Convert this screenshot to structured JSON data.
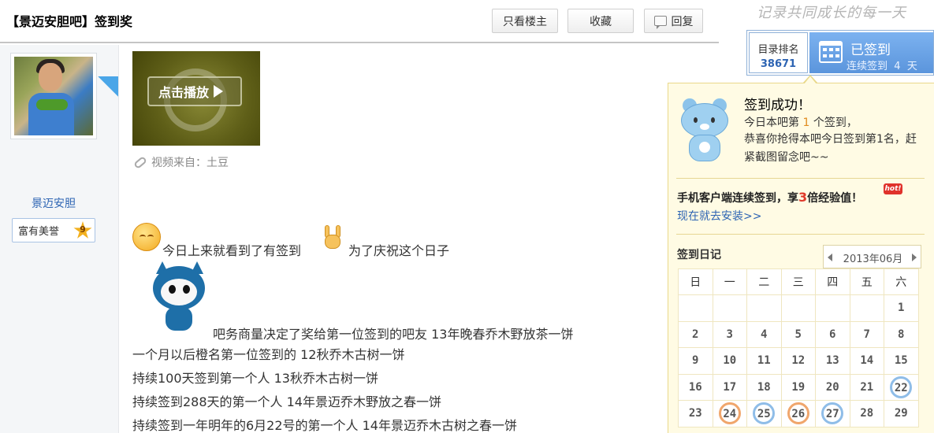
{
  "thread": {
    "title": "【景迈安胆吧】签到奖",
    "buttons": {
      "only_author": "只看楼主",
      "collect": "收藏",
      "reply": "回复"
    }
  },
  "author": {
    "name": "景迈安胆",
    "honor": "富有美誉",
    "honor_level": "9"
  },
  "post": {
    "video_play_label": "点击播放",
    "video_source": "视频来自：土豆",
    "lines": [
      "今日上来就看到了有签到",
      "为了庆祝这个日子",
      "吧务商量决定了奖给第一位签到的吧友 13年晚春乔木野放茶一饼",
      "一个月以后橙名第一位签到的 12秋乔木古树一饼",
      "持续100天签到第一个人 13秋乔木古树一饼",
      "持续签到288天的第一个人 14年景迈乔木野放之春一饼",
      "持续签到一年明年的6月22号的第一个人 14年景迈乔木古树之春一饼"
    ],
    "emojis": [
      "smile-emoji",
      "rock-hand-emoji",
      "blue-cat-emoji"
    ]
  },
  "sidebar": {
    "slogan": "记录共同成长的每一天",
    "rank_label": "目录排名",
    "rank_value": "38671",
    "signed_label": "已签到",
    "streak_prefix": "连续签到",
    "streak_days": "4",
    "streak_suffix": "天"
  },
  "popup": {
    "title": "签到成功！",
    "line1_prefix": "今日本吧第",
    "line1_rank": "1",
    "line1_suffix": "个签到，",
    "line2": "恭喜你抢得本吧今日签到第1名，赶",
    "line3": "紧截图留念吧~~",
    "mobile_prefix": "手机客户端连续签到，享",
    "mobile_multiplier": "3",
    "mobile_suffix": "倍经验值！",
    "hot_badge": "hot!",
    "install_link": "现在就去安装>>",
    "diary_title": "签到日记",
    "month": "2013年06月",
    "weekdays": [
      "日",
      "一",
      "二",
      "三",
      "四",
      "五",
      "六"
    ],
    "calendar_rows": [
      [
        "",
        "",
        "",
        "",
        "",
        "",
        "1"
      ],
      [
        "2",
        "3",
        "4",
        "5",
        "6",
        "7",
        "8"
      ],
      [
        "9",
        "10",
        "11",
        "12",
        "13",
        "14",
        "15"
      ],
      [
        "16",
        "17",
        "18",
        "19",
        "20",
        "21",
        "22"
      ],
      [
        "23",
        "24",
        "25",
        "26",
        "27",
        "28",
        "29"
      ]
    ],
    "signed_days_blue": [
      "22",
      "25",
      "27"
    ],
    "signed_days_orange": [
      "24",
      "26"
    ]
  }
}
